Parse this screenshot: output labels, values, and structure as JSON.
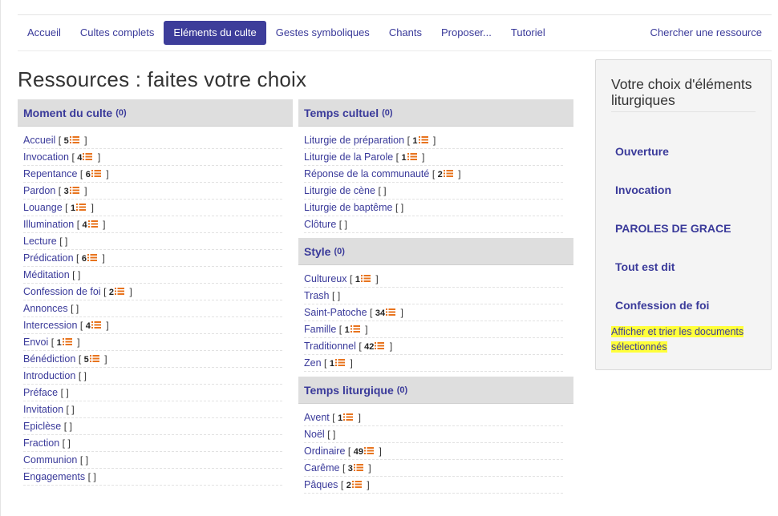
{
  "nav": {
    "items": [
      {
        "label": "Accueil",
        "active": false
      },
      {
        "label": "Cultes complets",
        "active": false
      },
      {
        "label": "Eléments du culte",
        "active": true
      },
      {
        "label": "Gestes symboliques",
        "active": false
      },
      {
        "label": "Chants",
        "active": false
      },
      {
        "label": "Proposer...",
        "active": false
      },
      {
        "label": "Tutoriel",
        "active": false
      }
    ],
    "search_label": "Chercher une ressource"
  },
  "page": {
    "title": "Ressources : faites votre choix"
  },
  "colors": {
    "accent": "#3d3d9a",
    "link": "#3a3a9a",
    "header_bg": "#dedede",
    "list_icon": "#e8741e",
    "highlight": "#ffff3a"
  },
  "sections": {
    "moment": {
      "title": "Moment du culte",
      "count": "(0)",
      "items": [
        {
          "label": "Accueil",
          "num": "5",
          "icon": "list-icon"
        },
        {
          "label": "Invocation",
          "num": "4",
          "icon": "list-icon"
        },
        {
          "label": "Repentance",
          "num": "6",
          "icon": "list-icon"
        },
        {
          "label": "Pardon",
          "num": "3",
          "icon": "list-icon"
        },
        {
          "label": "Louange",
          "num": "1",
          "icon": "list-icon"
        },
        {
          "label": "Illumination",
          "num": "4",
          "icon": "list-icon"
        },
        {
          "label": "Lecture",
          "num": "",
          "icon": ""
        },
        {
          "label": "Prédication",
          "num": "6",
          "icon": "list-icon"
        },
        {
          "label": "Méditation",
          "num": "",
          "icon": ""
        },
        {
          "label": "Confession de foi",
          "num": "2",
          "icon": "list-icon"
        },
        {
          "label": "Annonces",
          "num": "",
          "icon": ""
        },
        {
          "label": "Intercession",
          "num": "4",
          "icon": "list-icon"
        },
        {
          "label": "Envoi",
          "num": "1",
          "icon": "list-icon"
        },
        {
          "label": "Bénédiction",
          "num": "5",
          "icon": "list-icon"
        },
        {
          "label": "Introduction",
          "num": "",
          "icon": ""
        },
        {
          "label": "Préface",
          "num": "",
          "icon": ""
        },
        {
          "label": "Invitation",
          "num": "",
          "icon": ""
        },
        {
          "label": "Epiclèse",
          "num": "",
          "icon": ""
        },
        {
          "label": "Fraction",
          "num": "",
          "icon": ""
        },
        {
          "label": "Communion",
          "num": "",
          "icon": ""
        },
        {
          "label": "Engagements",
          "num": "",
          "icon": ""
        }
      ]
    },
    "temps_cultuel": {
      "title": "Temps cultuel",
      "count": "(0)",
      "items": [
        {
          "label": "Liturgie de préparation",
          "num": "1",
          "icon": "list-icon"
        },
        {
          "label": "Liturgie de la Parole",
          "num": "1",
          "icon": "list-icon"
        },
        {
          "label": "Réponse de la communauté",
          "num": "2",
          "icon": "list-icon"
        },
        {
          "label": "Liturgie de cène",
          "num": "",
          "icon": ""
        },
        {
          "label": "Liturgie de baptême",
          "num": "",
          "icon": ""
        },
        {
          "label": "Clôture",
          "num": "",
          "icon": ""
        }
      ]
    },
    "style": {
      "title": "Style",
      "count": "(0)",
      "items": [
        {
          "label": "Cultureux",
          "num": "1",
          "icon": "list-icon"
        },
        {
          "label": "Trash",
          "num": "",
          "icon": ""
        },
        {
          "label": "Saint-Patoche",
          "num": "34",
          "icon": "list-icon"
        },
        {
          "label": "Famille",
          "num": "1",
          "icon": "list-icon"
        },
        {
          "label": "Traditionnel",
          "num": "42",
          "icon": "list-icon"
        },
        {
          "label": "Zen",
          "num": "1",
          "icon": "list-icon"
        }
      ]
    },
    "temps_liturgique": {
      "title": "Temps liturgique",
      "count": "(0)",
      "items": [
        {
          "label": "Avent",
          "num": "1",
          "icon": "list-icon"
        },
        {
          "label": "Noël",
          "num": "",
          "icon": ""
        },
        {
          "label": "Ordinaire",
          "num": "49",
          "icon": "list-icon"
        },
        {
          "label": "Carême",
          "num": "3",
          "icon": "list-icon"
        },
        {
          "label": "Pâques",
          "num": "2",
          "icon": "list-icon"
        }
      ]
    }
  },
  "sidebar": {
    "title": "Votre choix d'éléments liturgiques",
    "selected": [
      "Ouverture",
      "Invocation",
      "PAROLES DE GRACE",
      "Tout est dit",
      "Confession de foi"
    ],
    "action_label": "Afficher et trier les documents sélectionnés"
  }
}
